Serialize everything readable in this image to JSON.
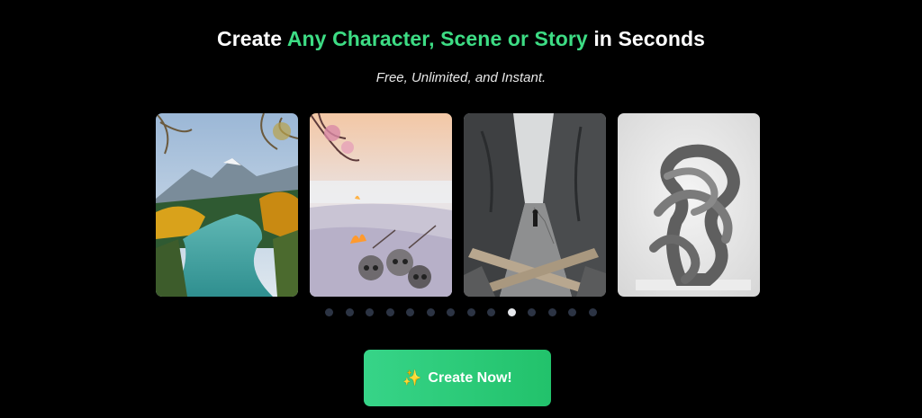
{
  "hero": {
    "title_prefix": "Create",
    "title_highlight": "Any Character, Scene or Story",
    "title_suffix": "in Seconds",
    "subtitle": "Free, Unlimited, and Instant.",
    "accent_color": "#3ddc84"
  },
  "carousel": {
    "slides": [
      {
        "icon": "river-landscape-image"
      },
      {
        "icon": "snowy-skulls-campfire-image"
      },
      {
        "icon": "canyon-crossroads-figure-image"
      },
      {
        "icon": "twisted-knot-sculpture-image"
      }
    ],
    "dot_count": 14,
    "active_dot": 9
  },
  "cta": {
    "icon": "sparkle-icon",
    "label": "Create Now!",
    "gradient_start": "#37d488",
    "gradient_end": "#22c26b"
  }
}
